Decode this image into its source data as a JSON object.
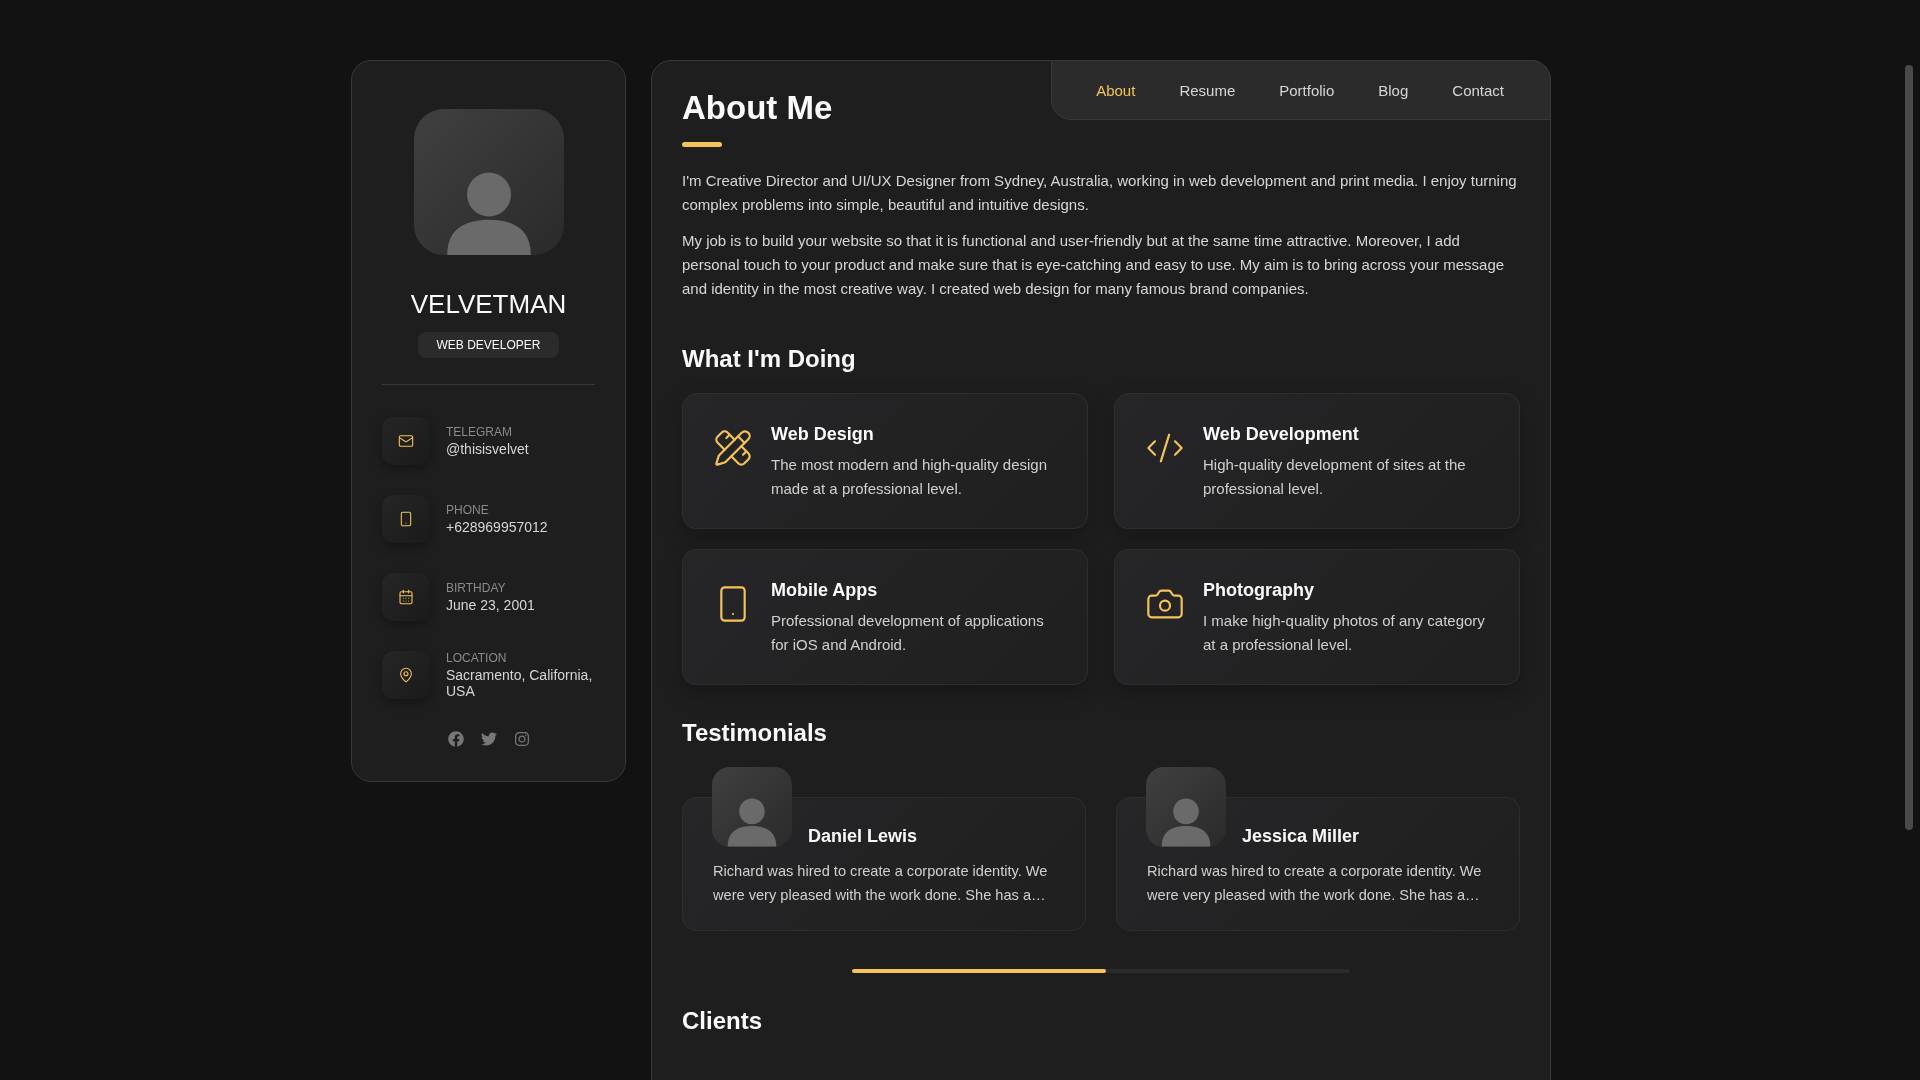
{
  "profile": {
    "name": "VELVETMAN",
    "role": "WEB DEVELOPER"
  },
  "contacts": [
    {
      "kind": "mail",
      "label": "TELEGRAM",
      "value": "@thisisvelvet"
    },
    {
      "kind": "phone",
      "label": "PHONE",
      "value": "+628969957012"
    },
    {
      "kind": "calendar",
      "label": "BIRTHDAY",
      "value": "June 23, 2001"
    },
    {
      "kind": "location",
      "label": "LOCATION",
      "value": "Sacramento, California, USA"
    }
  ],
  "social": [
    {
      "kind": "facebook"
    },
    {
      "kind": "twitter"
    },
    {
      "kind": "instagram"
    }
  ],
  "nav": [
    {
      "label": "About",
      "selected": true
    },
    {
      "label": "Resume",
      "selected": false
    },
    {
      "label": "Portfolio",
      "selected": false
    },
    {
      "label": "Blog",
      "selected": false
    },
    {
      "label": "Contact",
      "selected": false
    }
  ],
  "about": {
    "title": "About Me",
    "paragraphs": [
      "I'm Creative Director and UI/UX Designer from Sydney, Australia, working in web development and print media. I enjoy turning complex problems into simple, beautiful and intuitive designs.",
      "My job is to build your website so that it is functional and user-friendly but at the same time attractive. Moreover, I add personal touch to your product and make sure that is eye-catching and easy to use. My aim is to bring across your message and identity in the most creative way. I created web design for many famous brand companies."
    ]
  },
  "services": {
    "title": "What I'm Doing",
    "items": [
      {
        "kind": "design",
        "title": "Web Design",
        "text": "The most modern and high-quality design made at a professional level."
      },
      {
        "kind": "code",
        "title": "Web Development",
        "text": "High-quality development of sites at the professional level."
      },
      {
        "kind": "mobile",
        "title": "Mobile Apps",
        "text": "Professional development of applications for iOS and Android."
      },
      {
        "kind": "camera",
        "title": "Photography",
        "text": "I make high-quality photos of any category at a professional level."
      }
    ]
  },
  "testimonials": {
    "title": "Testimonials",
    "items": [
      {
        "name": "Daniel Lewis",
        "text": "Richard was hired to create a corporate identity. We were very pleased with the work done. She has a…"
      },
      {
        "name": "Jessica Miller",
        "text": "Richard was hired to create a corporate identity. We were very pleased with the work done. She has a…"
      }
    ],
    "progress": {
      "level": 0.51
    }
  },
  "clients": {
    "title": "Clients"
  }
}
